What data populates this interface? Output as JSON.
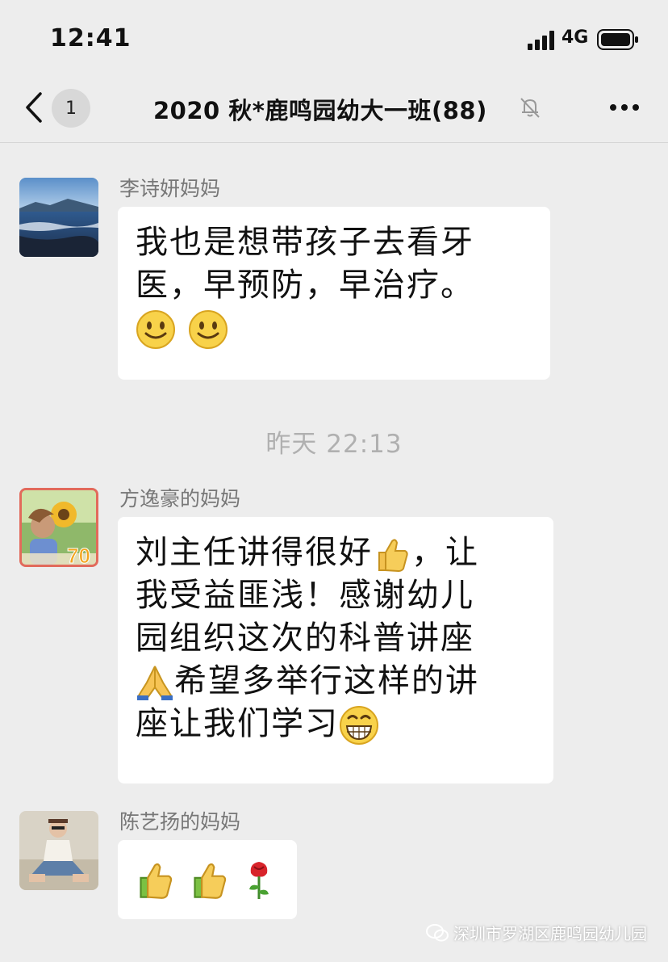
{
  "status_bar": {
    "time": "12:41",
    "network": "4G"
  },
  "nav": {
    "back_unread_count": "1",
    "title": "2020 秋*鹿鸣园幼大一班(88)"
  },
  "messages": [
    {
      "sender": "李诗妍妈妈",
      "avatar": "avatar-seaside-photo",
      "lines": [
        "我也是想带孩子去看牙",
        "医，早预防，早治疗。"
      ],
      "emoji": [
        "smile-emoji",
        "smile-emoji"
      ]
    },
    {
      "sender": "方逸豪的妈妈",
      "avatar": "avatar-child-sunflower-photo",
      "lines": [
        "刘主任讲得很好",
        "，让",
        "我受益匪浅！感谢幼儿",
        "园组织这次的科普讲座",
        "希望多举行这样的讲",
        "座让我们学习"
      ],
      "avatar_badge": "70",
      "emoji": [
        "thumbs-up-emoji",
        "pray-emoji",
        "grin-emoji"
      ]
    },
    {
      "sender": "陈艺扬的妈妈",
      "avatar": "avatar-woman-sitting-photo",
      "emoji": [
        "thumbs-up-emoji",
        "thumbs-up-emoji",
        "rose-emoji"
      ]
    }
  ],
  "timestamp": "昨天 22:13",
  "watermark": "深圳市罗湖区鹿鸣园幼儿园",
  "colors": {
    "background": "#ededed",
    "bubble": "#ffffff",
    "meta_text": "#b0b0b0"
  }
}
